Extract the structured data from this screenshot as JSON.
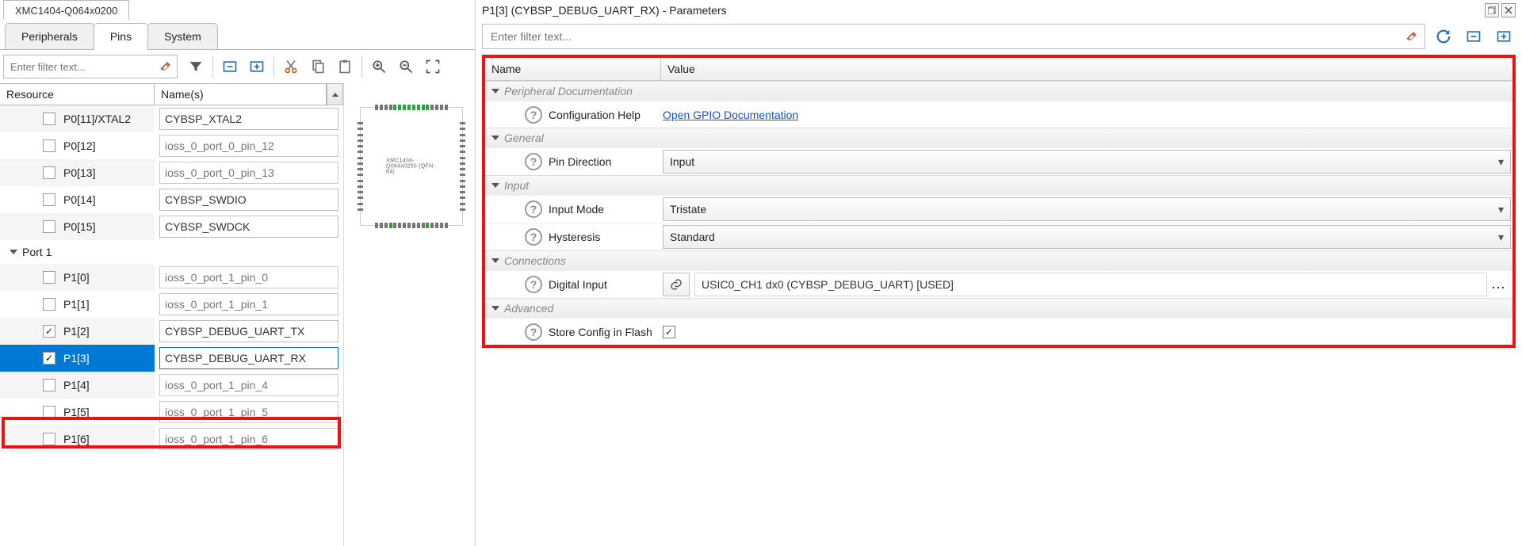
{
  "doc_tab": "XMC1404-Q064x0200",
  "main_tabs": {
    "peripherals": "Peripherals",
    "pins": "Pins",
    "system": "System",
    "active": "pins"
  },
  "left_filter_placeholder": "Enter filter text...",
  "res_header": {
    "resource": "Resource",
    "names": "Name(s)"
  },
  "pins": [
    {
      "id": "P0[11]/XTAL2",
      "checked": false,
      "name": "CYBSP_XTAL2",
      "ph": false
    },
    {
      "id": "P0[12]",
      "checked": false,
      "name": "ioss_0_port_0_pin_12",
      "ph": true
    },
    {
      "id": "P0[13]",
      "checked": false,
      "name": "ioss_0_port_0_pin_13",
      "ph": true
    },
    {
      "id": "P0[14]",
      "checked": false,
      "name": "CYBSP_SWDIO",
      "ph": false
    },
    {
      "id": "P0[15]",
      "checked": false,
      "name": "CYBSP_SWDCK",
      "ph": false
    }
  ],
  "port_group": "Port 1",
  "port1": [
    {
      "id": "P1[0]",
      "checked": false,
      "name": "ioss_0_port_1_pin_0",
      "ph": true
    },
    {
      "id": "P1[1]",
      "checked": false,
      "name": "ioss_0_port_1_pin_1",
      "ph": true
    },
    {
      "id": "P1[2]",
      "checked": true,
      "name": "CYBSP_DEBUG_UART_TX",
      "ph": false
    },
    {
      "id": "P1[3]",
      "checked": true,
      "name": "CYBSP_DEBUG_UART_RX",
      "ph": false,
      "selected": true
    },
    {
      "id": "P1[4]",
      "checked": false,
      "name": "ioss_0_port_1_pin_4",
      "ph": true
    },
    {
      "id": "P1[5]",
      "checked": false,
      "name": "ioss_0_port_1_pin_5",
      "ph": true
    },
    {
      "id": "P1[6]",
      "checked": false,
      "name": "ioss_0_port_1_pin_6",
      "ph": true
    }
  ],
  "pkg_label": "XMC1404-Q064x0200  (QFN-64)",
  "right_title": "P1[3] (CYBSP_DEBUG_UART_RX) - Parameters",
  "right_filter_placeholder": "Enter filter text...",
  "param_header": {
    "name": "Name",
    "value": "Value"
  },
  "groups": {
    "pd": "Peripheral Documentation",
    "gen": "General",
    "inp": "Input",
    "con": "Connections",
    "adv": "Advanced"
  },
  "params": {
    "cfg_help": {
      "label": "Configuration Help",
      "value": "Open GPIO Documentation"
    },
    "pin_dir": {
      "label": "Pin Direction",
      "value": "Input"
    },
    "in_mode": {
      "label": "Input Mode",
      "value": "Tristate"
    },
    "hyst": {
      "label": "Hysteresis",
      "value": "Standard"
    },
    "dig_in": {
      "label": "Digital Input",
      "value": "USIC0_CH1 dx0 (CYBSP_DEBUG_UART) [USED]"
    },
    "store": {
      "label": "Store Config in Flash",
      "checked": true
    }
  }
}
